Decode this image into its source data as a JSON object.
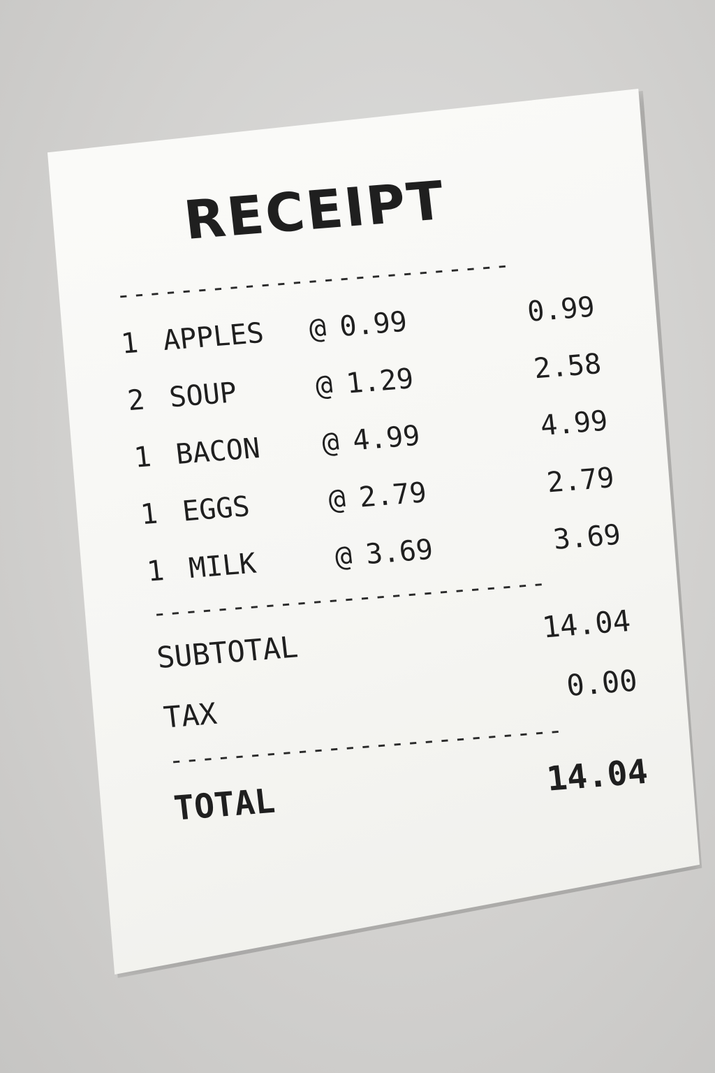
{
  "receipt": {
    "title": "RECEIPT",
    "rule": "-------------------------",
    "items": [
      {
        "qty": "1",
        "name": "APPLES",
        "at": "@",
        "unit_price": "0.99",
        "amount": "0.99"
      },
      {
        "qty": "2",
        "name": "SOUP",
        "at": "@",
        "unit_price": "1.29",
        "amount": "2.58"
      },
      {
        "qty": "1",
        "name": "BACON",
        "at": "@",
        "unit_price": "4.99",
        "amount": "4.99"
      },
      {
        "qty": "1",
        "name": "EGGS",
        "at": "@",
        "unit_price": "2.79",
        "amount": "2.79"
      },
      {
        "qty": "1",
        "name": "MILK",
        "at": "@",
        "unit_price": "3.69",
        "amount": "3.69"
      }
    ],
    "subtotal_label": "SUBTOTAL",
    "subtotal_value": "14.04",
    "tax_label": "TAX",
    "tax_value": "0.00",
    "total_label": "TOTAL",
    "total_value": "14.04"
  }
}
